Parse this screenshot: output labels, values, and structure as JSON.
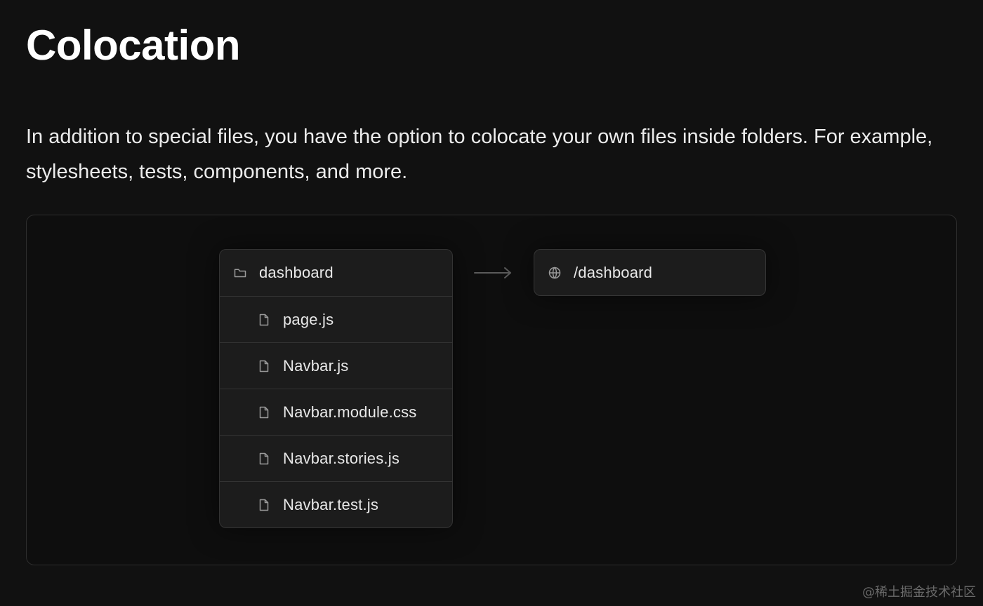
{
  "title": "Colocation",
  "intro": "In addition to special files, you have the option to colocate your own files inside folders. For example, stylesheets, tests, components, and more.",
  "diagram": {
    "folder": {
      "icon": "folder-icon",
      "label": "dashboard"
    },
    "files": [
      {
        "icon": "file-icon",
        "label": "page.js"
      },
      {
        "icon": "file-icon",
        "label": "Navbar.js"
      },
      {
        "icon": "file-icon",
        "label": "Navbar.module.css"
      },
      {
        "icon": "file-icon",
        "label": "Navbar.stories.js"
      },
      {
        "icon": "file-icon",
        "label": "Navbar.test.js"
      }
    ],
    "arrow_icon": "arrow-right-icon",
    "route": {
      "icon": "globe-icon",
      "label": "/dashboard"
    }
  },
  "watermark": "@稀土掘金技术社区"
}
